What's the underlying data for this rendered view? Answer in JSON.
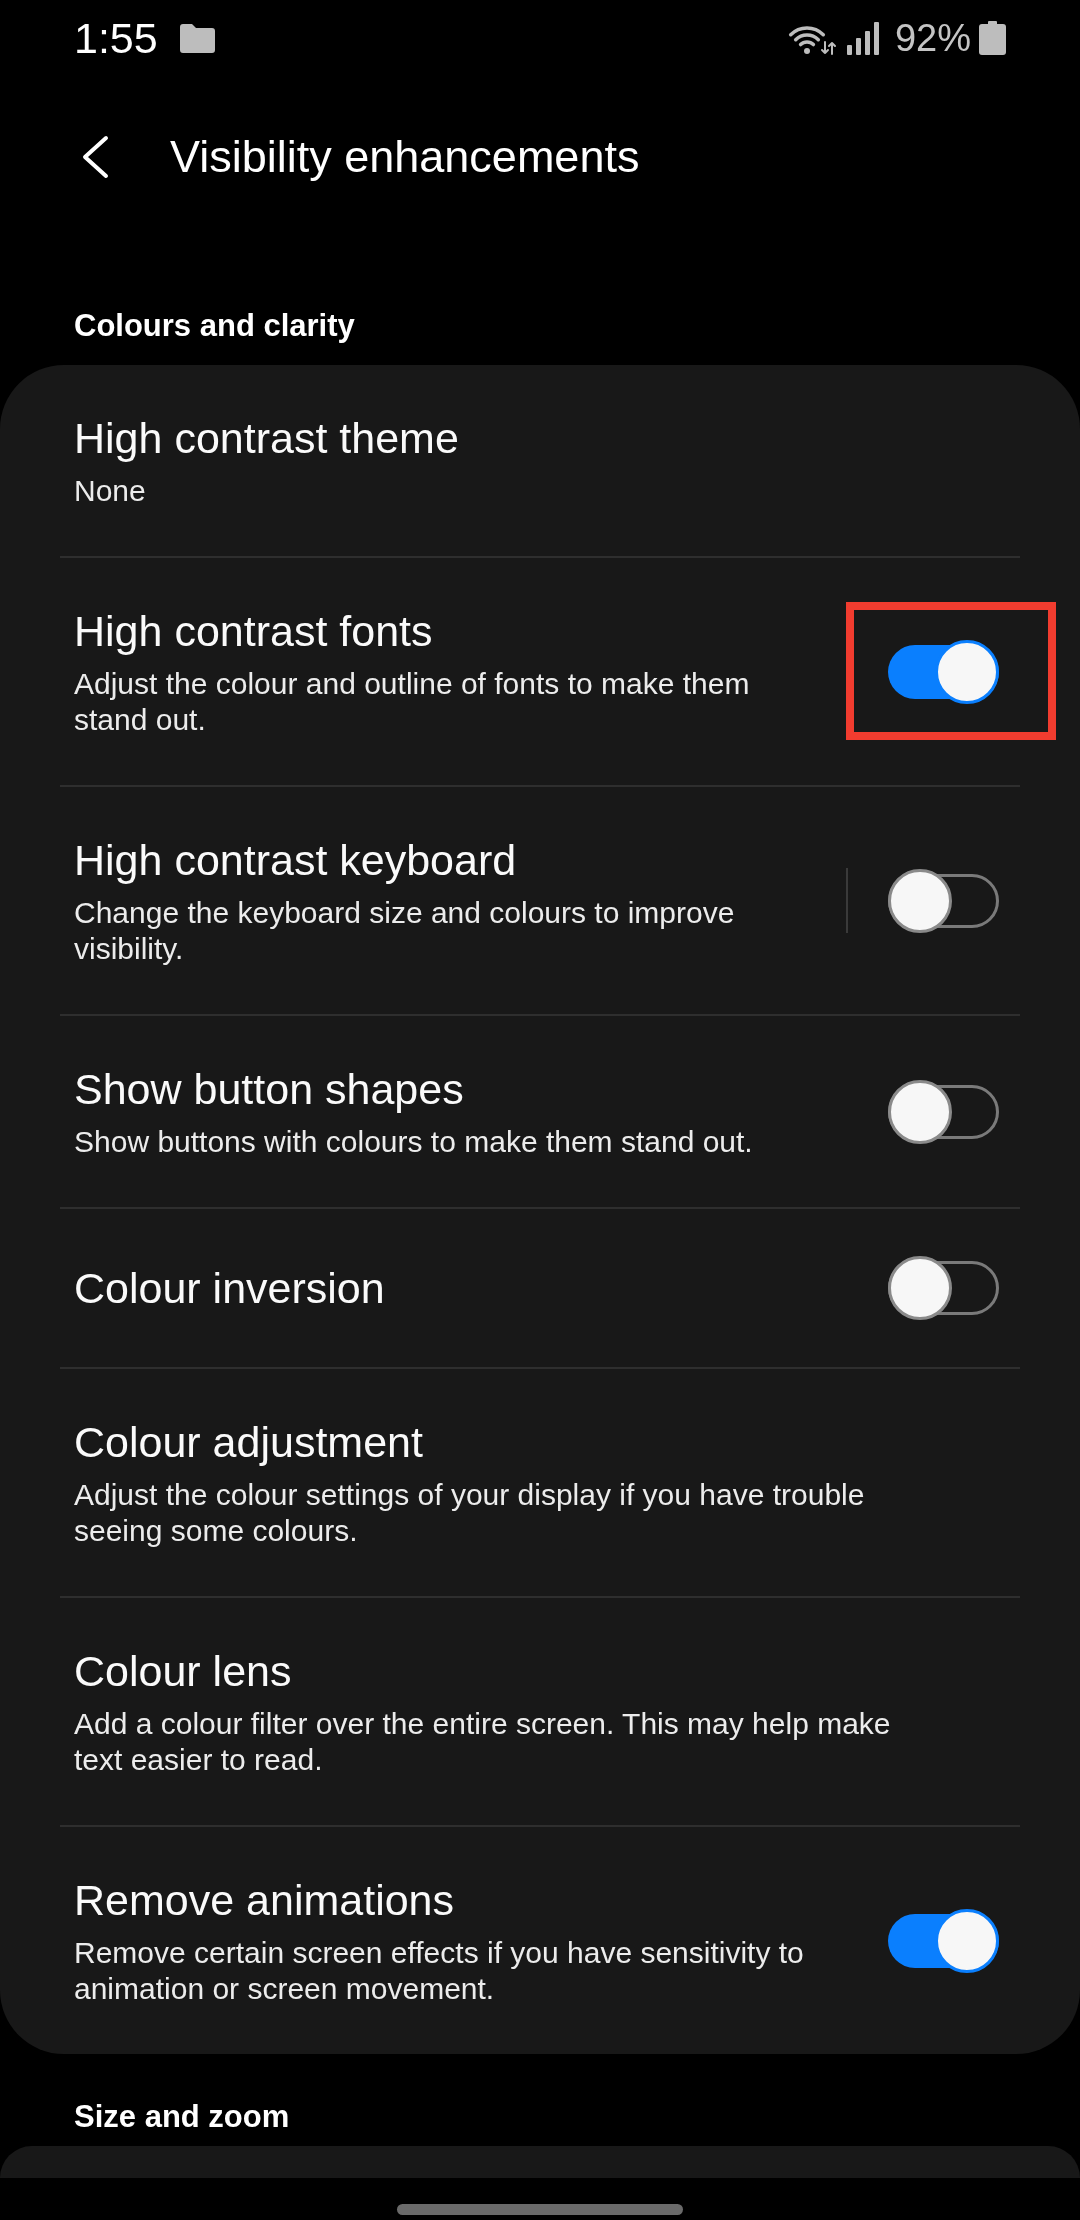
{
  "status_bar": {
    "time": "1:55",
    "battery": "92%"
  },
  "header": {
    "title": "Visibility enhancements"
  },
  "sections": [
    {
      "title": "Colours and clarity",
      "items": [
        {
          "kind": "value",
          "title": "High contrast theme",
          "value": "None"
        },
        {
          "kind": "switch",
          "title": "High contrast fonts",
          "description": "Adjust the colour and outline of fonts to make them stand out.",
          "on": true,
          "split": false,
          "highlighted": true
        },
        {
          "kind": "switch",
          "title": "High contrast keyboard",
          "description": "Change the keyboard size and colours to improve visibility.",
          "on": false,
          "split": true,
          "highlighted": false
        },
        {
          "kind": "switch",
          "title": "Show button shapes",
          "description": "Show buttons with colours to make them stand out.",
          "on": false,
          "split": false,
          "highlighted": false
        },
        {
          "kind": "switch",
          "title": "Colour inversion",
          "on": false,
          "split": false,
          "highlighted": false
        },
        {
          "kind": "link",
          "title": "Colour adjustment",
          "description": "Adjust the colour settings of your display if you have trouble seeing some colours."
        },
        {
          "kind": "link",
          "title": "Colour lens",
          "description": "Add a colour filter over the entire screen. This may help make text easier to read."
        },
        {
          "kind": "switch",
          "title": "Remove animations",
          "description": "Remove certain screen effects if you have sensitivity to animation or screen movement.",
          "on": true,
          "split": false,
          "highlighted": false
        }
      ]
    },
    {
      "title": "Size and zoom"
    }
  ]
}
